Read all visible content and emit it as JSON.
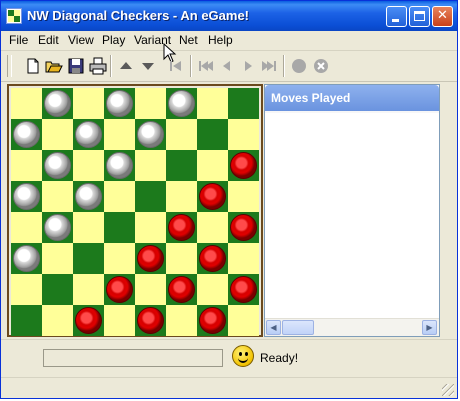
{
  "window": {
    "title": "NW Diagonal Checkers - An eGame!",
    "controls": [
      "minimize-icon",
      "maximize-icon",
      "close-icon"
    ]
  },
  "menu": {
    "items": [
      "File",
      "Edit",
      "View",
      "Play",
      "Variant",
      "Net",
      "Help"
    ]
  },
  "toolbar": {
    "buttons": [
      "new-icon",
      "open-icon",
      "save-icon",
      "print-icon",
      "move-up-icon",
      "move-down-icon",
      "first-icon",
      "back-icon",
      "previous-icon",
      "next-icon",
      "last-icon",
      "stop-icon",
      "cancel-icon"
    ]
  },
  "board": {
    "size": 8,
    "colors": {
      "light": "#ffff99",
      "dark": "#1c7a1c",
      "border": "#6b4a1e"
    },
    "pieces": [
      {
        "row": 0,
        "col": 1,
        "color": "white"
      },
      {
        "row": 0,
        "col": 3,
        "color": "white"
      },
      {
        "row": 0,
        "col": 5,
        "color": "white"
      },
      {
        "row": 1,
        "col": 0,
        "color": "white"
      },
      {
        "row": 1,
        "col": 2,
        "color": "white"
      },
      {
        "row": 1,
        "col": 4,
        "color": "white"
      },
      {
        "row": 2,
        "col": 1,
        "color": "white"
      },
      {
        "row": 2,
        "col": 3,
        "color": "white"
      },
      {
        "row": 2,
        "col": 7,
        "color": "red"
      },
      {
        "row": 3,
        "col": 0,
        "color": "white"
      },
      {
        "row": 3,
        "col": 2,
        "color": "white"
      },
      {
        "row": 3,
        "col": 6,
        "color": "red"
      },
      {
        "row": 4,
        "col": 1,
        "color": "white"
      },
      {
        "row": 4,
        "col": 5,
        "color": "red"
      },
      {
        "row": 4,
        "col": 7,
        "color": "red"
      },
      {
        "row": 5,
        "col": 0,
        "color": "white"
      },
      {
        "row": 5,
        "col": 4,
        "color": "red"
      },
      {
        "row": 5,
        "col": 6,
        "color": "red"
      },
      {
        "row": 6,
        "col": 3,
        "color": "red"
      },
      {
        "row": 6,
        "col": 5,
        "color": "red"
      },
      {
        "row": 6,
        "col": 7,
        "color": "red"
      },
      {
        "row": 7,
        "col": 2,
        "color": "red"
      },
      {
        "row": 7,
        "col": 4,
        "color": "red"
      },
      {
        "row": 7,
        "col": 6,
        "color": "red"
      }
    ]
  },
  "moves_panel": {
    "title": "Moves Played",
    "moves": []
  },
  "status": {
    "text": "Ready!",
    "smiley": "smiley-icon"
  }
}
